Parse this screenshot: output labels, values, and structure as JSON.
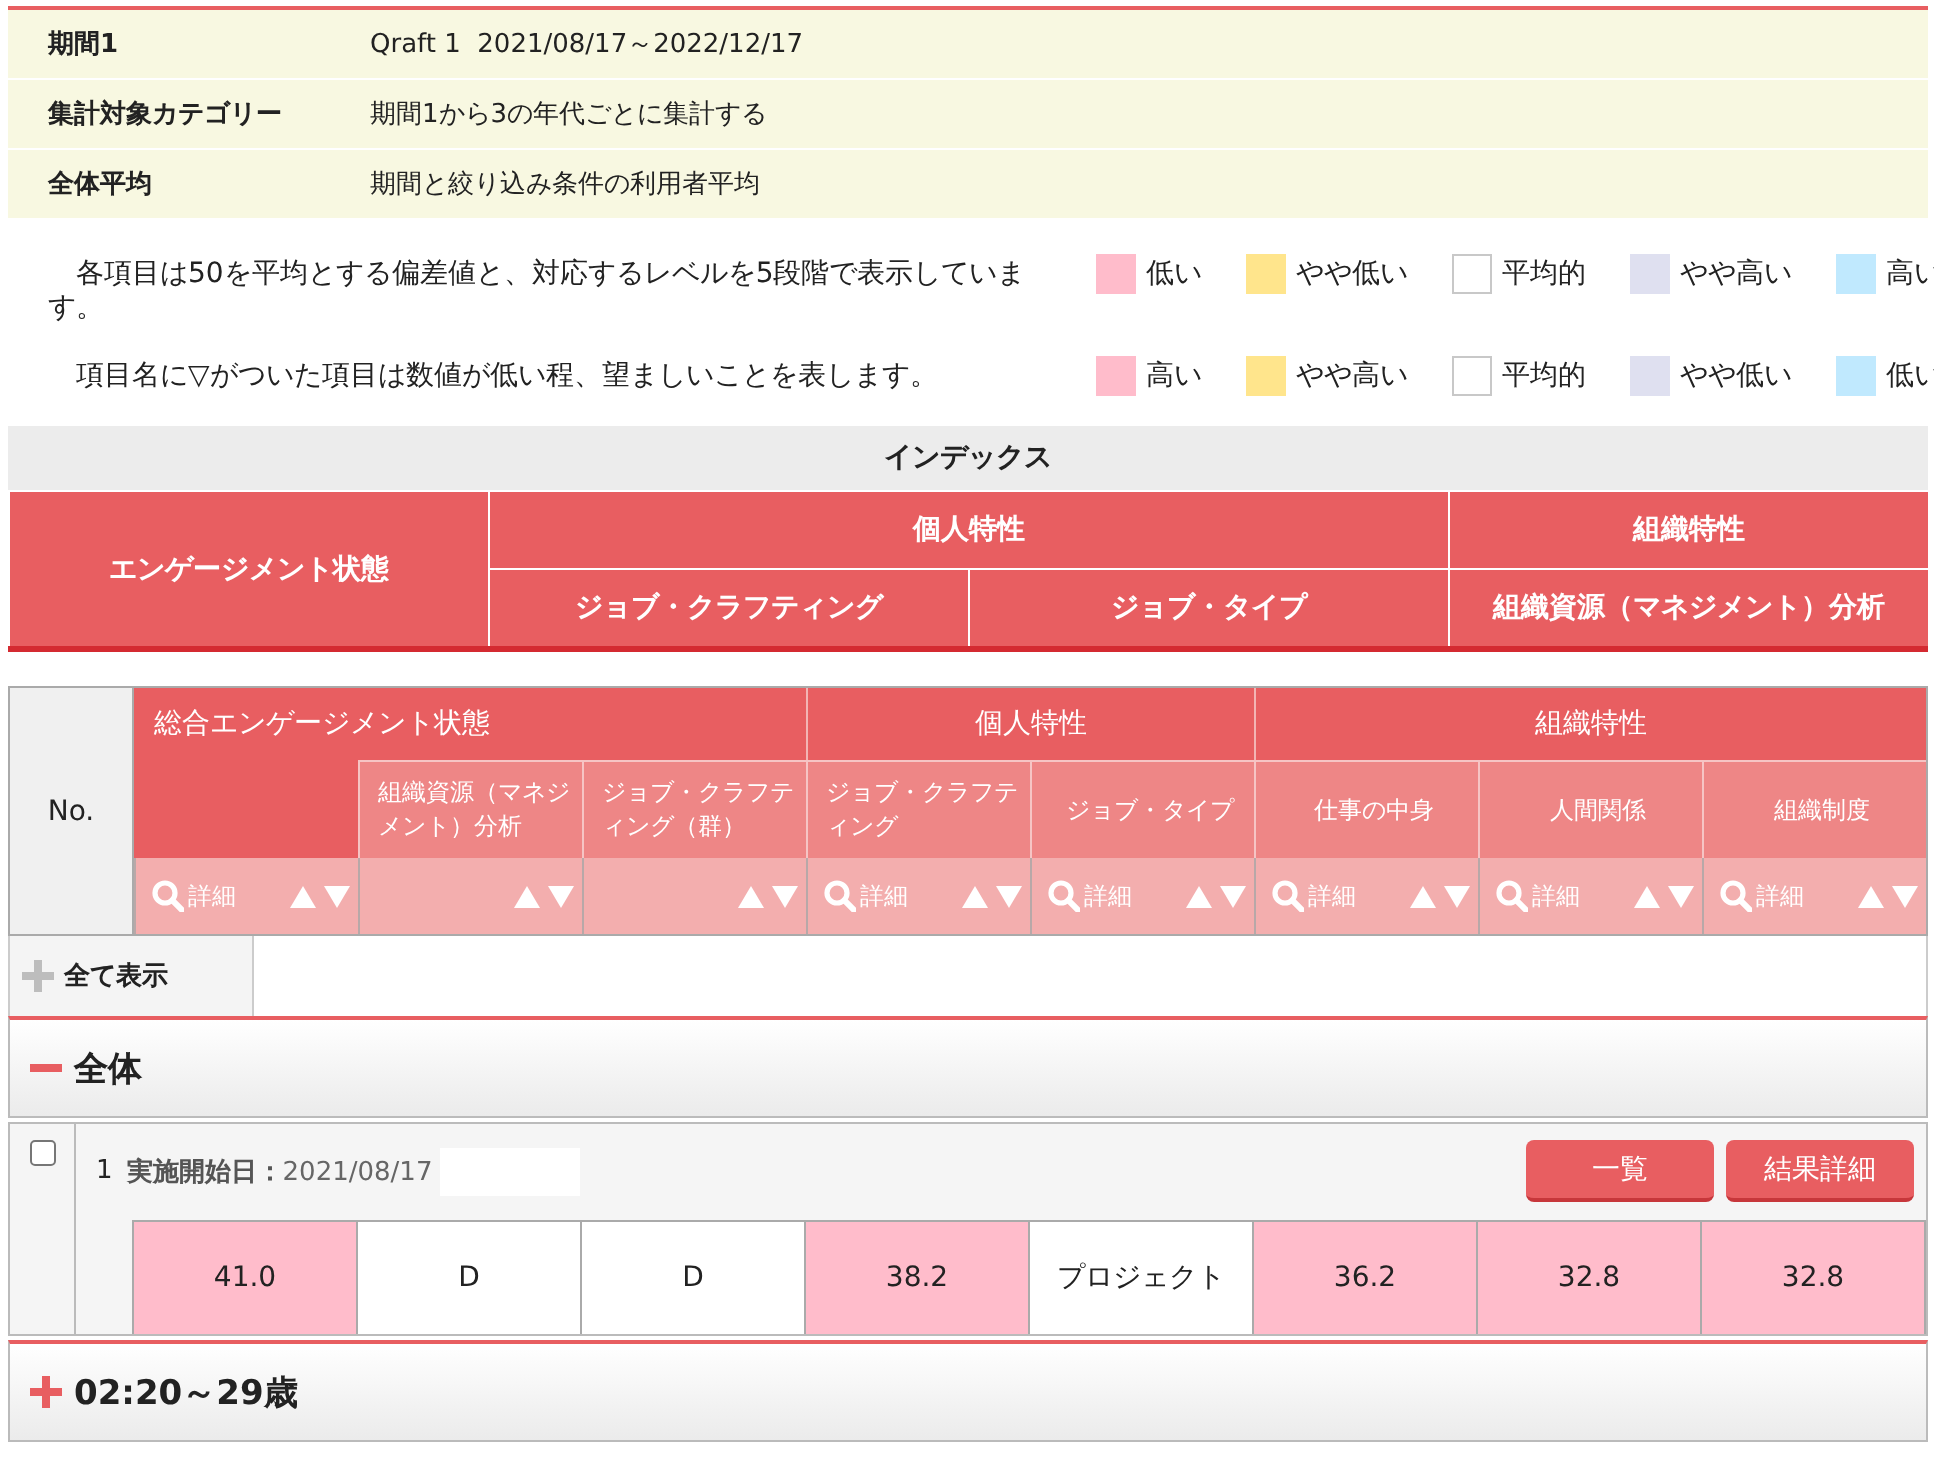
{
  "info": [
    {
      "label": "期間1",
      "value": "Qraft 1  2021/08/17～2022/12/17"
    },
    {
      "label": "集計対象カテゴリー",
      "value": "期間1から3の年代ごとに集計する"
    },
    {
      "label": "全体平均",
      "value": "期間と絞り込み条件の利用者平均"
    }
  ],
  "legend": [
    {
      "text": "各項目は50を平均とする偏差値と、対応するレベルを5段階で表示しています。",
      "items": [
        {
          "label": "低い",
          "color": "#ffbccb"
        },
        {
          "label": "やや低い",
          "color": "#ffe58c"
        },
        {
          "label": "平均的",
          "color": "#ffffff"
        },
        {
          "label": "やや高い",
          "color": "#dfe0f0"
        },
        {
          "label": "高い",
          "color": "#c0e9fe"
        }
      ]
    },
    {
      "text": "項目名に▽がついた項目は数値が低い程、望ましいことを表します。",
      "items": [
        {
          "label": "高い",
          "color": "#ffbccb"
        },
        {
          "label": "やや高い",
          "color": "#ffe58c"
        },
        {
          "label": "平均的",
          "color": "#ffffff"
        },
        {
          "label": "やや低い",
          "color": "#dfe0f0"
        },
        {
          "label": "低い",
          "color": "#c0e9fe"
        }
      ]
    }
  ],
  "index": {
    "title": "インデックス",
    "sections": [
      {
        "label": "エンゲージメント状態"
      },
      {
        "label": "個人特性",
        "items": [
          "ジョブ・クラフティング",
          "ジョブ・タイプ"
        ]
      },
      {
        "label": "組織特性",
        "items": [
          "組織資源（マネジメント）分析"
        ]
      }
    ]
  },
  "main_table": {
    "no_label": "No.",
    "groups": [
      {
        "label": "総合エンゲージメント状態",
        "columns": [
          {
            "detail": "詳細"
          },
          {
            "label": "組織資源（マネジメント）分析"
          },
          {
            "label": "ジョブ・クラフティング（群）"
          }
        ]
      },
      {
        "label": "個人特性",
        "columns": [
          {
            "label": "ジョブ・クラフティング",
            "detail": "詳細"
          },
          {
            "label": "ジョブ・タイプ",
            "detail": "詳細"
          }
        ]
      },
      {
        "label": "組織特性",
        "columns": [
          {
            "label": "仕事の中身",
            "detail": "詳細"
          },
          {
            "label": "人間関係",
            "detail": "詳細"
          },
          {
            "label": "組織制度",
            "detail": "詳細"
          }
        ]
      }
    ]
  },
  "show_all": "全て表示",
  "sections": [
    {
      "label": "全体",
      "expanded": true,
      "rows": [
        {
          "no": "1",
          "checked": false,
          "start": "**実施開始日：**2021/08/17",
          "buttons": [
            "一覧",
            "結果詳細"
          ],
          "cells": [
            {
              "value": "41.0",
              "color": "#ffbccb"
            },
            {
              "value": "D",
              "color": "#ffffff"
            },
            {
              "value": "D",
              "color": "#ffffff"
            },
            {
              "value": "38.2",
              "color": "#ffbccb"
            },
            {
              "value": "プロジェクト",
              "color": "#ffffff"
            },
            {
              "value": "36.2",
              "color": "#ffbccb"
            },
            {
              "value": "32.8",
              "color": "#ffbccb"
            },
            {
              "value": "32.8",
              "color": "#ffbccb"
            }
          ]
        }
      ]
    },
    {
      "label": "02:20～29歳",
      "expanded": false
    }
  ]
}
